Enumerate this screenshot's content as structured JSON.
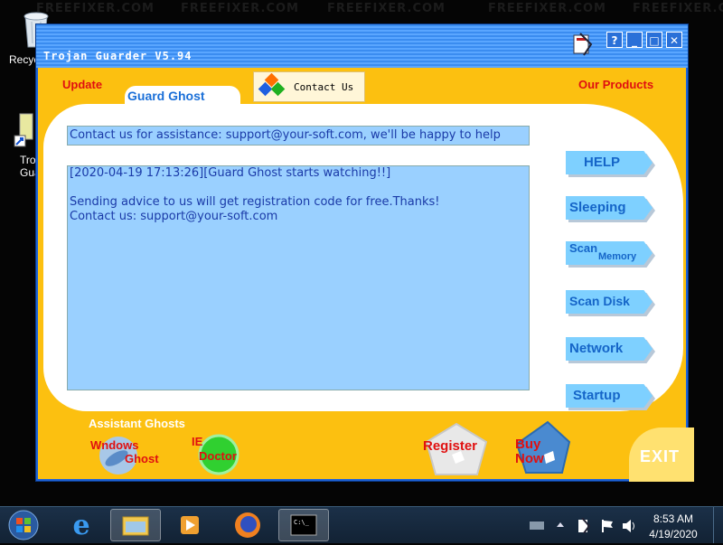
{
  "window": {
    "title": "Trojan Guarder V5.94",
    "controls": {
      "help": "?",
      "minimize": "_",
      "maximize": "□",
      "close": "✕"
    }
  },
  "desktop": {
    "watermark": "FREEFIXER.COM",
    "icons": [
      {
        "label": "Recyc"
      },
      {
        "label": "Tro\nGua"
      }
    ]
  },
  "topbar": {
    "update": "Update",
    "contact_us": "Contact Us",
    "our_products": "Our Products",
    "tab": "Guard Ghost"
  },
  "main": {
    "contact_line": "Contact us for assistance: support@your-soft.com, we'll be happy to help you!!",
    "log_lines": [
      "[2020-04-19 17:13:26][Guard Ghost starts watching!!]",
      "",
      "Sending advice to us will get registration code for free.Thanks!",
      "Contact us: support@your-soft.com"
    ]
  },
  "side_buttons": [
    {
      "label": "HELP"
    },
    {
      "label": "Sleeping"
    },
    {
      "label_line1": "Scan",
      "label_line2": "Memory"
    },
    {
      "label": "Scan Disk"
    },
    {
      "label": "Network"
    },
    {
      "label": "Startup"
    }
  ],
  "bottom": {
    "assistant_title": "Assistant Ghosts",
    "windows_ghost_1": "Wndows",
    "windows_ghost_2": "Ghost",
    "ie_doctor_1": "IE",
    "ie_doctor_2": "Doctor",
    "register": "Register",
    "buy_now_1": "Buy",
    "buy_now_2": "Now",
    "exit": "EXIT"
  },
  "taskbar": {
    "time": "8:53 AM",
    "date": "4/19/2020",
    "items": [
      "start-orb",
      "internet-explorer",
      "file-explorer",
      "media-player",
      "firefox",
      "command-prompt"
    ]
  },
  "colors": {
    "window_blue": "#1f63d8",
    "body_yellow": "#fcc010",
    "accent_red": "#e01010",
    "log_bg": "#9ad0ff"
  }
}
